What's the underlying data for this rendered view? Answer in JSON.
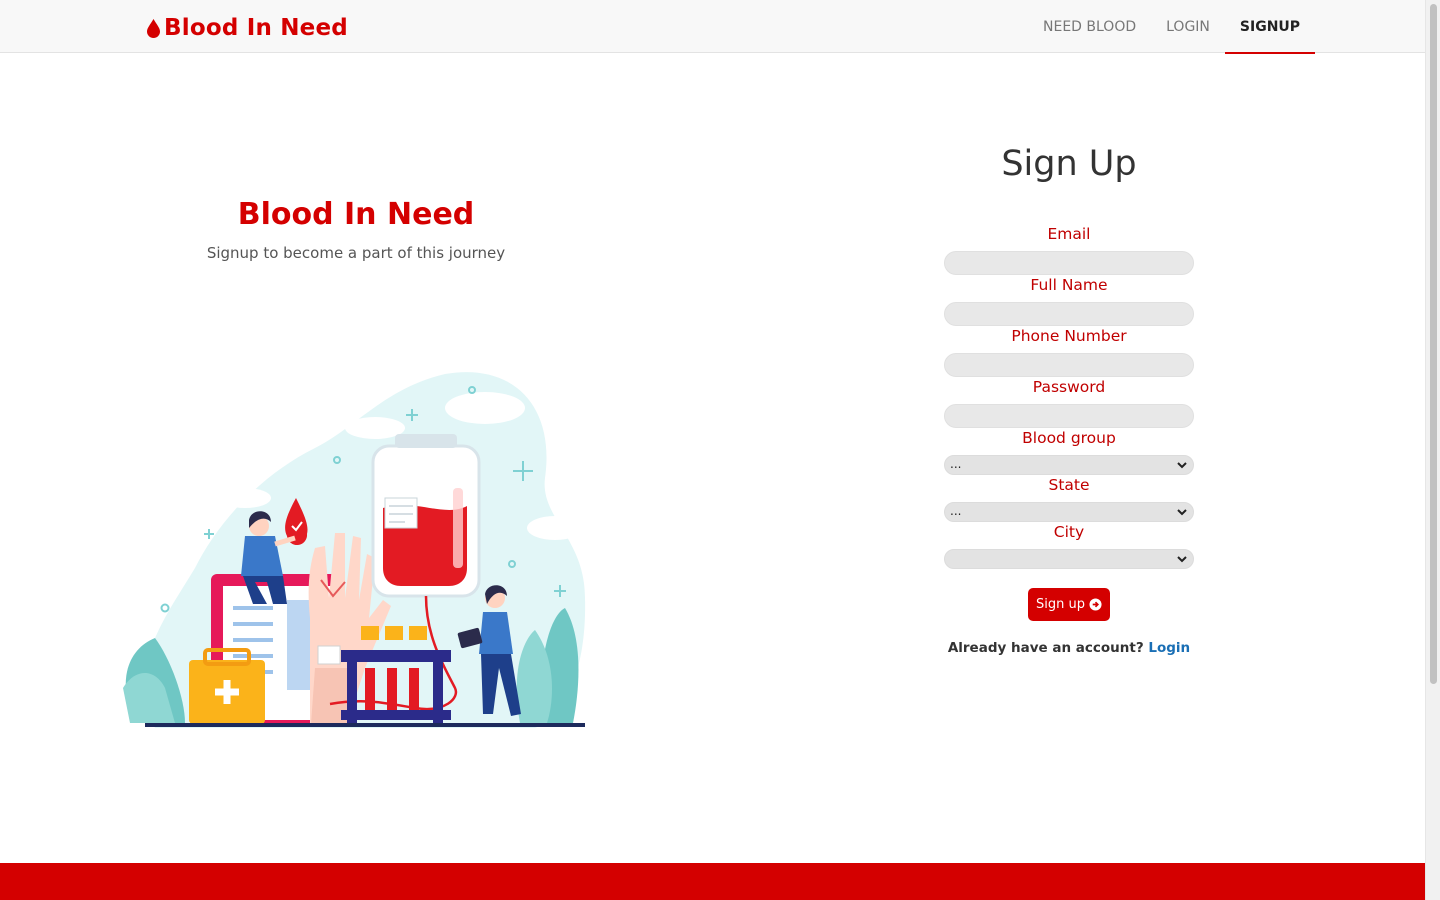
{
  "nav": {
    "brand": "Blood In Need",
    "links": [
      "NEED BLOOD",
      "LOGIN",
      "SIGNUP"
    ],
    "active": "SIGNUP"
  },
  "hero": {
    "title": "Blood In Need",
    "subtitle": "Signup to become a part of this journey"
  },
  "form": {
    "title": "Sign Up",
    "fields": {
      "email": {
        "label": "Email",
        "value": ""
      },
      "full_name": {
        "label": "Full Name",
        "value": ""
      },
      "phone": {
        "label": "Phone Number",
        "value": ""
      },
      "password": {
        "label": "Password",
        "value": ""
      },
      "blood_group": {
        "label": "Blood group",
        "value": "..."
      },
      "state": {
        "label": "State",
        "value": "..."
      },
      "city": {
        "label": "City",
        "value": ""
      }
    },
    "submit_label": "Sign up",
    "login_prompt": "Already have an account?",
    "login_link": "Login"
  },
  "colors": {
    "brand_red": "#d40000",
    "label_red": "#c00000",
    "link_blue": "#1a6fb5",
    "footer": "#d40000"
  },
  "icons": {
    "brand": "blood-drop-icon",
    "submit": "arrow-circle-right-icon",
    "select": "chevron-down-icon"
  }
}
